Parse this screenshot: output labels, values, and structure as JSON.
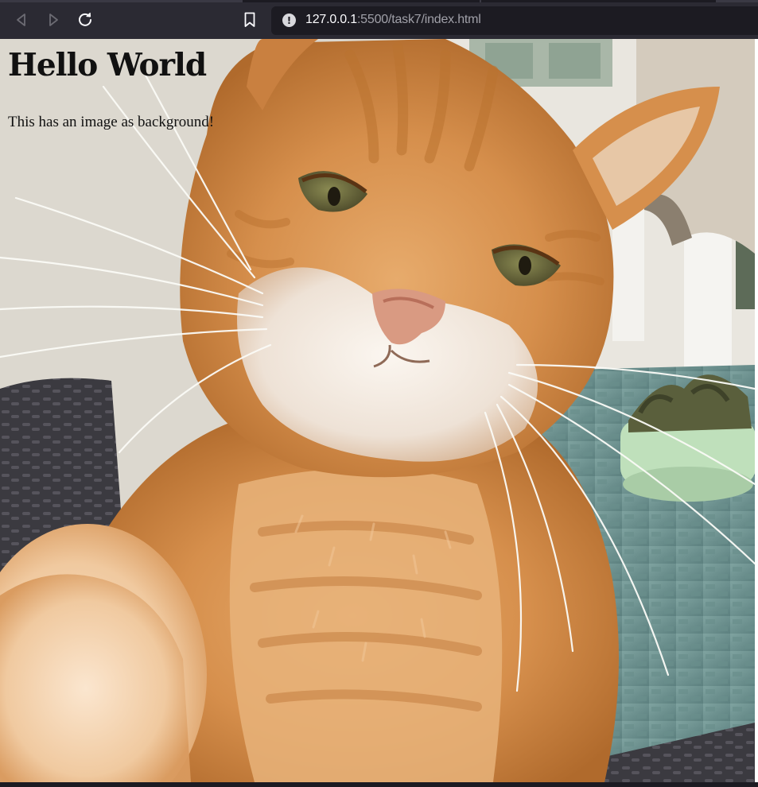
{
  "browser": {
    "address": {
      "host": "127.0.0.1",
      "rest": ":5500/task7/index.html"
    },
    "icons": {
      "back": "back-arrow-icon",
      "forward": "forward-arrow-icon",
      "reload": "reload-icon",
      "bookmark": "bookmark-icon",
      "site_info": "info-icon"
    },
    "colors": {
      "toolbar": "#2b2a33",
      "urlbar": "#1c1b22"
    }
  },
  "page": {
    "heading": "Hello World",
    "paragraph": "This has an image as background!",
    "background_image": "orange tabby cat selfie photo"
  }
}
